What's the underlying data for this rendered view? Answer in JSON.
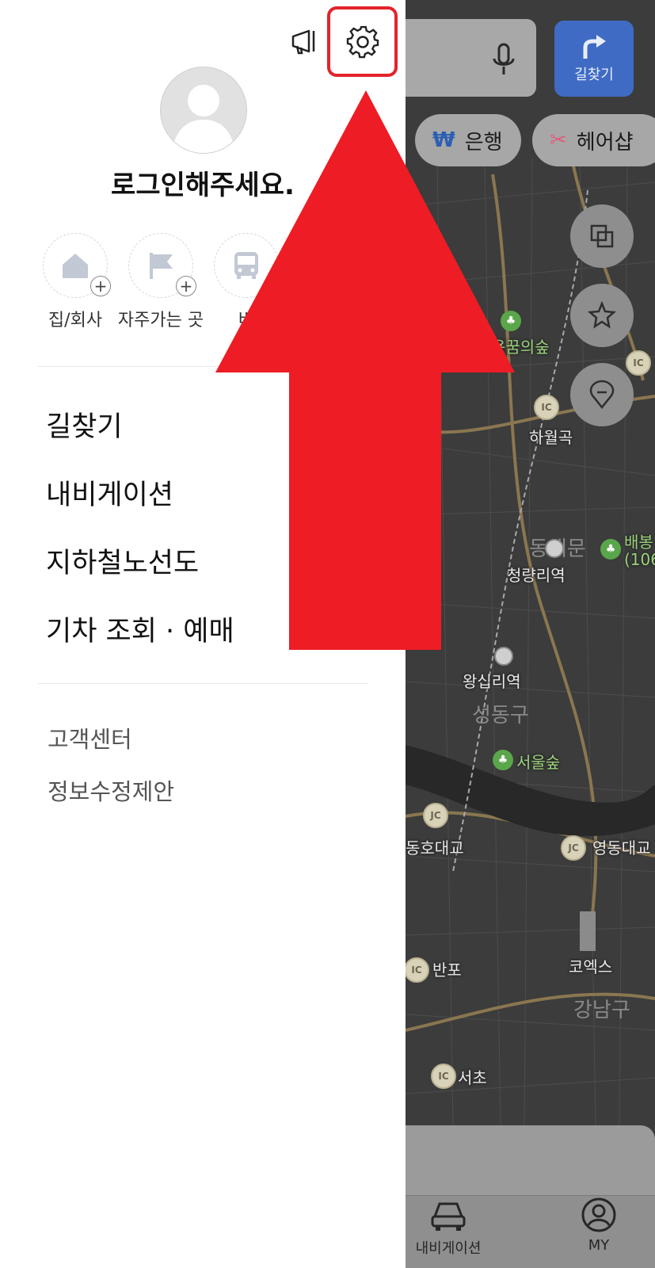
{
  "drawer": {
    "login_prompt": "로그인해주세요.",
    "quick_links": [
      {
        "label": "집/회사",
        "icon": "home-icon"
      },
      {
        "label": "자주가는 곳",
        "icon": "flag-icon"
      },
      {
        "label": "버",
        "icon": "bus-icon"
      }
    ],
    "menu": [
      "길찾기",
      "내비게이션",
      "지하철노선도",
      "기차 조회 · 예매"
    ],
    "sub_menu": [
      "고객센터",
      "정보수정제안"
    ]
  },
  "map": {
    "route_button_label": "길찾기",
    "chips": [
      {
        "label": "은행",
        "icon": "₩"
      },
      {
        "label": "헤어샵",
        "icon": "✂"
      }
    ],
    "places": [
      "용꿈의숲",
      "하월곡",
      "동대문",
      "청량리역",
      "배봉",
      "(106",
      "왕십리역",
      "성동구",
      "서울숲",
      "동호대교",
      "영동대교",
      "코엑스",
      "반포",
      "강남구",
      "서초"
    ],
    "badges": [
      "IC",
      "JC"
    ],
    "nav": [
      "내비게이션",
      "MY"
    ]
  },
  "colors": {
    "highlight": "#e3232b",
    "arrow": "#ee1c25",
    "route_button": "#3f6bc4"
  }
}
